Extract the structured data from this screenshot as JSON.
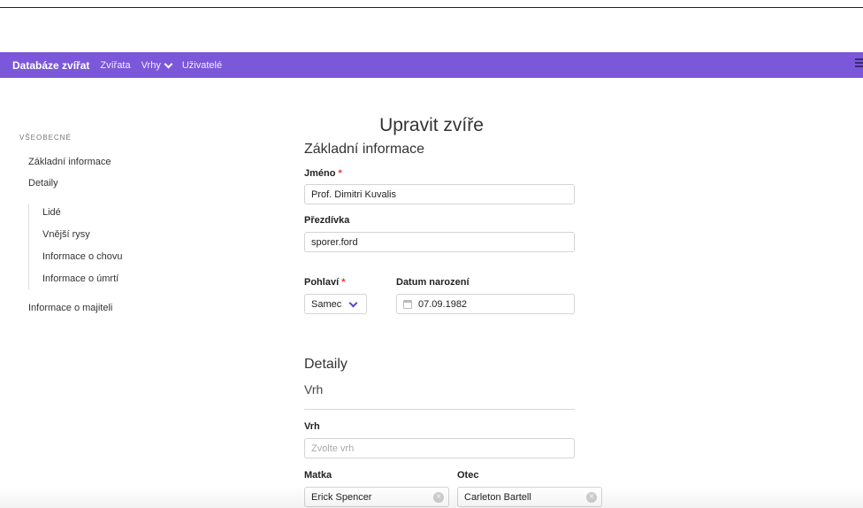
{
  "navbar": {
    "brand": "Databáze zvířat",
    "links": [
      {
        "label": "Zvířata"
      },
      {
        "label": "Vrhy"
      },
      {
        "label": "Uživatelé"
      }
    ]
  },
  "sidebar": {
    "heading": "VŠEOBECNÉ",
    "items": [
      {
        "label": "Základní informace"
      },
      {
        "label": "Detaily"
      },
      {
        "label": "Lidé"
      },
      {
        "label": "Vnější rysy"
      },
      {
        "label": "Informace o chovu"
      },
      {
        "label": "Informace o úmrtí"
      },
      {
        "label": "Informace o majiteli"
      }
    ]
  },
  "page": {
    "title": "Upravit zvíře",
    "basic_section": "Základní informace",
    "details_section": "Detaily",
    "litter_subsection": "Vrh"
  },
  "form": {
    "name_label": "Jméno",
    "name_value": "Prof. Dimitri Kuvalis",
    "nickname_label": "Přezdívka",
    "nickname_value": "sporer.ford",
    "sex_label": "Pohlaví",
    "sex_value": "Samec",
    "birth_label": "Datum narození",
    "birth_value": "07.09.1982",
    "litter_label": "Vrh",
    "litter_placeholder": "Zvolte vrh",
    "mother_label": "Matka",
    "mother_value": "Erick Spencer",
    "father_label": "Otec",
    "father_value": "Carleton Bartell",
    "required_mark": "*"
  },
  "icons": {
    "calendar": "calendar-icon",
    "clear": "clear-icon",
    "menu": "hamburger-menu-icon"
  },
  "colors": {
    "navbar": "#7b57d9",
    "required": "#e53935"
  }
}
